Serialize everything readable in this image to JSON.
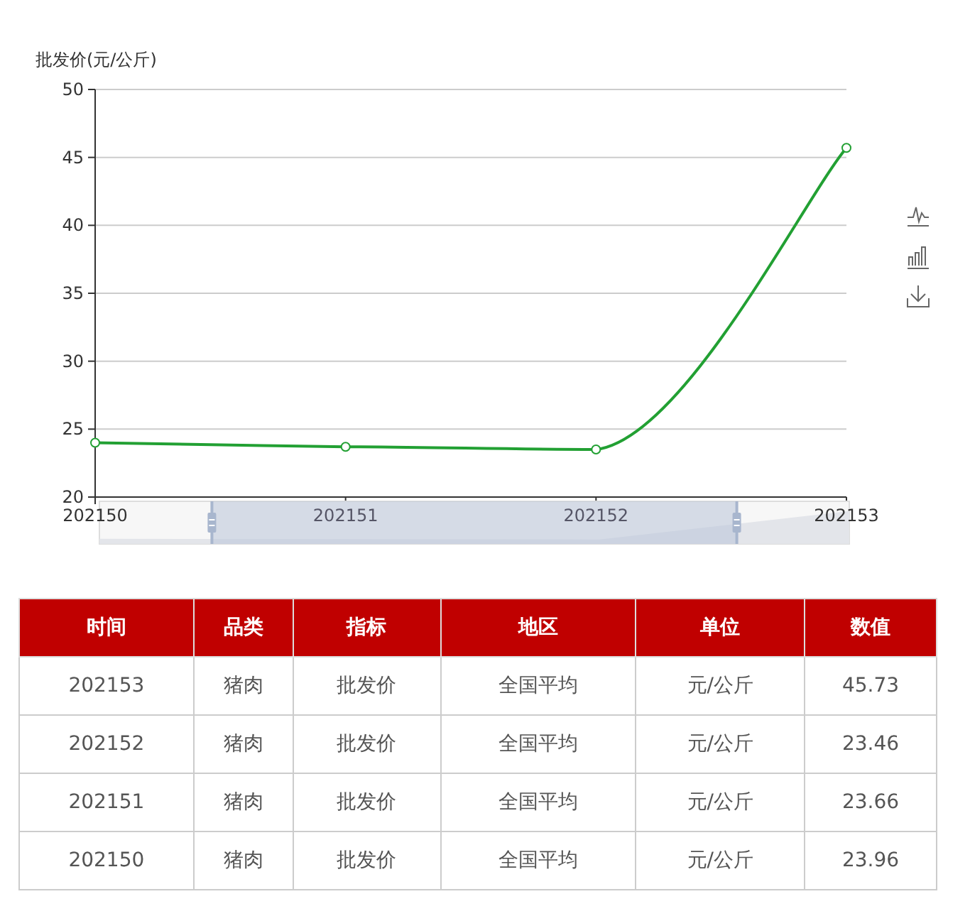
{
  "chart": {
    "chart_data": {
      "type": "line",
      "ylabel": "批发价(元/公斤)",
      "categories": [
        "202150",
        "202151",
        "202152",
        "202153"
      ],
      "series": [
        {
          "color": "#22a033",
          "marker": true,
          "values": [
            24.0,
            23.7,
            23.5,
            45.7
          ]
        }
      ],
      "ylim": [
        20,
        50
      ],
      "yticks": [
        20,
        25,
        30,
        35,
        40,
        45,
        50
      ],
      "grid": true
    }
  },
  "table": {
    "columns": [
      "时间",
      "品类",
      "指标",
      "地区",
      "单位",
      "数值"
    ],
    "rows": [
      [
        "202153",
        "猪肉",
        "批发价",
        "全国平均",
        "元/公斤",
        "45.73"
      ],
      [
        "202152",
        "猪肉",
        "批发价",
        "全国平均",
        "元/公斤",
        "23.46"
      ],
      [
        "202151",
        "猪肉",
        "批发价",
        "全国平均",
        "元/公斤",
        "23.66"
      ],
      [
        "202150",
        "猪肉",
        "批发价",
        "全国平均",
        "元/公斤",
        "23.96"
      ]
    ]
  }
}
